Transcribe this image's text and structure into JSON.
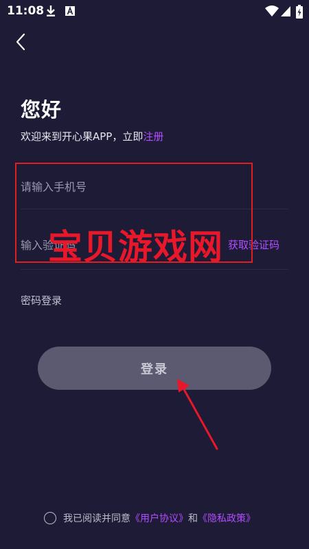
{
  "status_bar": {
    "time": "11:08",
    "icons": [
      "download-icon",
      "font-a-icon",
      "wifi-icon",
      "signal-icon",
      "battery-charging-icon"
    ]
  },
  "nav": {
    "back_icon": "chevron-left-icon"
  },
  "header": {
    "title": "您好",
    "subtitle_prefix": "欢迎来到开心果APP，立即",
    "register_link": "注册"
  },
  "form": {
    "phone_placeholder": "请输入手机号",
    "code_placeholder": "输入验证码",
    "get_code_label": "获取验证码",
    "password_login_label": "密码登录",
    "login_button_label": "登录"
  },
  "agreement": {
    "prefix": "我已阅读并同意",
    "user_agreement": "《用户协议》",
    "and": "和",
    "privacy_policy": "《隐私政策》"
  },
  "watermark": {
    "text": "宝贝游戏网"
  },
  "colors": {
    "background": "#1d1b36",
    "accent": "#b44dff",
    "button": "#5b5a70",
    "watermark": "#e8182a"
  }
}
